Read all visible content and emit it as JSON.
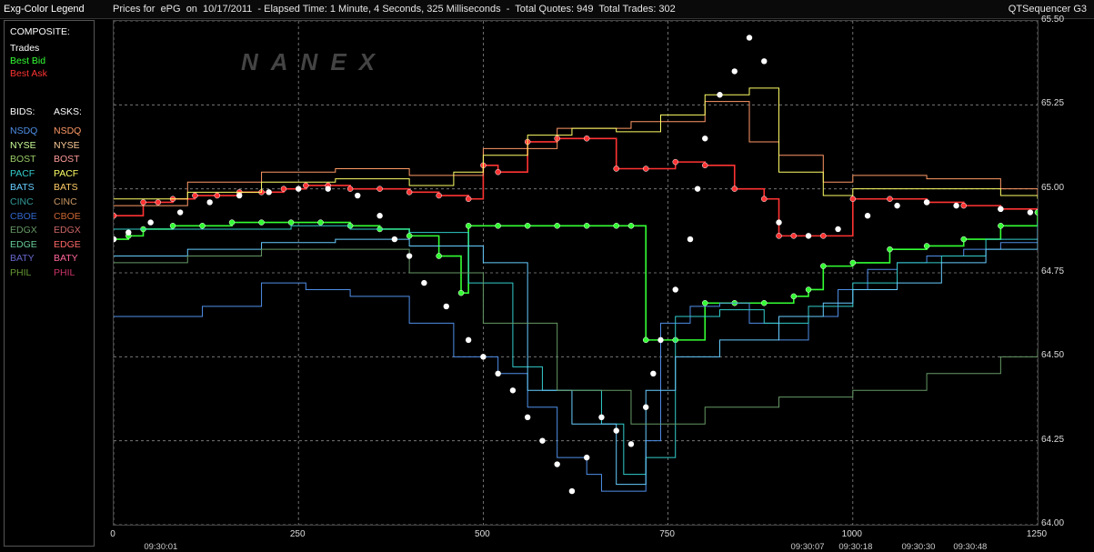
{
  "window": {
    "legend_title": "Exg-Color Legend",
    "chart_title": "Prices for  ePG  on  10/17/2011  - Elapsed Time: 1 Minute, 4 Seconds, 325 Milliseconds  -  Total Quotes: 949  Total Trades: 302",
    "app_name": "QTSequencer G3"
  },
  "legend": {
    "composite_label": "COMPOSITE:",
    "composite": [
      {
        "label": "Trades",
        "color": "#ffffff"
      },
      {
        "label": "Best Bid",
        "color": "#33ff33"
      },
      {
        "label": "Best Ask",
        "color": "#ff3333"
      }
    ],
    "bids_label": "BIDS:",
    "asks_label": "ASKS:",
    "exchanges": [
      {
        "bid": "NSDQ",
        "ask": "NSDQ",
        "bid_color": "#4f8fe8",
        "ask_color": "#ff9966"
      },
      {
        "bid": "NYSE",
        "ask": "NYSE",
        "bid_color": "#ccff99",
        "ask_color": "#ffcc99"
      },
      {
        "bid": "BOST",
        "ask": "BOST",
        "bid_color": "#99cc66",
        "ask_color": "#ff9999"
      },
      {
        "bid": "PACF",
        "ask": "PACF",
        "bid_color": "#33cccc",
        "ask_color": "#ffff66"
      },
      {
        "bid": "BATS",
        "ask": "BATS",
        "bid_color": "#66ccff",
        "ask_color": "#ffcc66"
      },
      {
        "bid": "CINC",
        "ask": "CINC",
        "bid_color": "#339999",
        "ask_color": "#cc9966"
      },
      {
        "bid": "CBOE",
        "ask": "CBOE",
        "bid_color": "#3366cc",
        "ask_color": "#cc6633"
      },
      {
        "bid": "EDGX",
        "ask": "EDGX",
        "bid_color": "#669966",
        "ask_color": "#cc6666"
      },
      {
        "bid": "EDGE",
        "ask": "EDGE",
        "bid_color": "#66cc99",
        "ask_color": "#ff6666"
      },
      {
        "bid": "BATY",
        "ask": "BATY",
        "bid_color": "#6666cc",
        "ask_color": "#ff6699"
      },
      {
        "bid": "PHIL",
        "ask": "PHIL",
        "bid_color": "#669933",
        "ask_color": "#cc3366"
      }
    ]
  },
  "watermark": "NANEX",
  "chart_data": {
    "type": "line",
    "title": "",
    "ylim": [
      64.0,
      65.5
    ],
    "xlim": [
      0,
      1250
    ],
    "y_ticks": [
      "65.50",
      "65.25",
      "65.00",
      "64.75",
      "64.50",
      "64.25",
      "64.00"
    ],
    "y_tick_values": [
      65.5,
      65.25,
      65.0,
      64.75,
      64.5,
      64.25,
      64.0
    ],
    "x_ticks": [
      "0",
      "250",
      "500",
      "750",
      "1000",
      "1250"
    ],
    "x_tick_values": [
      0,
      250,
      500,
      750,
      1000,
      1250
    ],
    "time_labels": [
      {
        "label": "09:30:01",
        "x": 65
      },
      {
        "label": "09:30:07",
        "x": 940
      },
      {
        "label": "09:30:18",
        "x": 1005
      },
      {
        "label": "09:30:30",
        "x": 1090
      },
      {
        "label": "09:30:48",
        "x": 1160
      }
    ],
    "grid": true,
    "series": [
      {
        "name": "Best Ask",
        "color": "#ff3333",
        "x": [
          0,
          40,
          60,
          80,
          110,
          140,
          170,
          200,
          230,
          260,
          290,
          320,
          360,
          400,
          440,
          480,
          500,
          520,
          560,
          600,
          640,
          680,
          720,
          760,
          800,
          840,
          880,
          900,
          920,
          960,
          1000,
          1050,
          1100,
          1150,
          1200,
          1250
        ],
        "y": [
          64.92,
          64.96,
          64.96,
          64.97,
          64.98,
          64.98,
          64.99,
          64.99,
          65.0,
          65.01,
          65.01,
          65.0,
          65.0,
          64.99,
          64.98,
          64.97,
          65.07,
          65.05,
          65.14,
          65.15,
          65.15,
          65.06,
          65.06,
          65.08,
          65.07,
          65.0,
          64.97,
          64.86,
          64.86,
          64.86,
          64.97,
          64.97,
          64.96,
          64.95,
          64.94,
          64.93
        ]
      },
      {
        "name": "Best Bid",
        "color": "#33ff33",
        "x": [
          0,
          20,
          40,
          80,
          120,
          160,
          200,
          240,
          280,
          320,
          360,
          400,
          440,
          470,
          480,
          520,
          560,
          600,
          640,
          680,
          700,
          720,
          760,
          800,
          840,
          880,
          920,
          940,
          960,
          1000,
          1050,
          1100,
          1150,
          1200,
          1250
        ],
        "y": [
          64.85,
          64.86,
          64.88,
          64.89,
          64.89,
          64.9,
          64.9,
          64.9,
          64.9,
          64.89,
          64.88,
          64.86,
          64.8,
          64.69,
          64.89,
          64.89,
          64.89,
          64.89,
          64.89,
          64.89,
          64.89,
          64.55,
          64.55,
          64.66,
          64.66,
          64.66,
          64.68,
          64.7,
          64.77,
          64.78,
          64.82,
          64.83,
          64.85,
          64.89,
          64.93
        ]
      },
      {
        "name": "NSDQ",
        "color": "#4f8fe8",
        "x": [
          0,
          60,
          120,
          200,
          260,
          320,
          400,
          460,
          520,
          560,
          600,
          640,
          660,
          700,
          720,
          740,
          780,
          820,
          860,
          900,
          940,
          980,
          1020,
          1060,
          1100,
          1150,
          1200,
          1250
        ],
        "y": [
          64.62,
          64.62,
          64.65,
          64.72,
          64.7,
          64.68,
          64.6,
          64.5,
          64.45,
          64.35,
          64.2,
          64.15,
          64.1,
          64.1,
          64.25,
          64.6,
          64.65,
          64.66,
          64.6,
          64.55,
          64.62,
          64.7,
          64.76,
          64.78,
          64.8,
          64.82,
          64.84,
          64.86
        ]
      },
      {
        "name": "PACF",
        "color": "#33cccc",
        "x": [
          0,
          80,
          160,
          240,
          320,
          400,
          480,
          540,
          580,
          620,
          660,
          690,
          720,
          760,
          820,
          880,
          940,
          1000,
          1060,
          1120,
          1180,
          1250
        ],
        "y": [
          64.88,
          64.88,
          64.88,
          64.89,
          64.88,
          64.87,
          64.72,
          64.47,
          64.4,
          64.4,
          64.3,
          64.15,
          64.2,
          64.62,
          64.64,
          64.6,
          64.65,
          64.72,
          64.78,
          64.8,
          64.85,
          64.9
        ]
      },
      {
        "name": "BATS",
        "color": "#66ccff",
        "x": [
          0,
          100,
          200,
          300,
          400,
          500,
          560,
          620,
          680,
          720,
          760,
          820,
          900,
          960,
          1000,
          1060,
          1120,
          1180,
          1250
        ],
        "y": [
          64.8,
          64.82,
          64.84,
          64.85,
          64.83,
          64.78,
          64.4,
          64.3,
          64.12,
          64.4,
          64.5,
          64.55,
          64.62,
          64.66,
          64.7,
          64.72,
          64.78,
          64.82,
          64.88
        ]
      },
      {
        "name": "EDGX",
        "color": "#669966",
        "x": [
          0,
          100,
          200,
          300,
          400,
          500,
          600,
          700,
          800,
          900,
          1000,
          1100,
          1200,
          1250
        ],
        "y": [
          64.78,
          64.8,
          64.82,
          64.82,
          64.75,
          64.6,
          64.4,
          64.3,
          64.35,
          64.38,
          64.4,
          64.45,
          64.5,
          64.52
        ]
      },
      {
        "name": "NSDQ ask",
        "color": "#ff9966",
        "x": [
          0,
          100,
          200,
          300,
          400,
          500,
          600,
          700,
          800,
          860,
          900,
          960,
          1000,
          1100,
          1200,
          1250
        ],
        "y": [
          64.95,
          65.02,
          65.05,
          65.06,
          65.04,
          65.12,
          65.18,
          65.2,
          65.26,
          65.14,
          65.1,
          65.02,
          65.04,
          65.03,
          65.0,
          64.98
        ]
      },
      {
        "name": "PACF ask",
        "color": "#ffff66",
        "x": [
          0,
          100,
          200,
          300,
          400,
          460,
          500,
          560,
          620,
          680,
          740,
          800,
          860,
          900,
          960,
          1000,
          1100,
          1200,
          1250
        ],
        "y": [
          64.97,
          64.99,
          65.02,
          65.03,
          65.01,
          65.05,
          65.1,
          65.16,
          65.18,
          65.17,
          65.22,
          65.28,
          65.3,
          65.05,
          64.98,
          65.0,
          65.0,
          64.98,
          64.97
        ]
      }
    ],
    "trades": {
      "name": "Trades",
      "color": "#ffffff",
      "x": [
        0,
        20,
        50,
        90,
        130,
        170,
        210,
        250,
        290,
        330,
        360,
        380,
        400,
        420,
        450,
        480,
        500,
        520,
        540,
        560,
        580,
        600,
        620,
        640,
        660,
        680,
        700,
        720,
        730,
        740,
        760,
        780,
        790,
        800,
        820,
        840,
        860,
        880,
        900,
        940,
        980,
        1020,
        1060,
        1100,
        1140,
        1200,
        1240
      ],
      "y": [
        64.85,
        64.87,
        64.9,
        64.93,
        64.96,
        64.98,
        64.99,
        65.0,
        65.0,
        64.98,
        64.92,
        64.85,
        64.8,
        64.72,
        64.65,
        64.55,
        64.5,
        64.45,
        64.4,
        64.32,
        64.25,
        64.18,
        64.1,
        64.2,
        64.32,
        64.28,
        64.24,
        64.35,
        64.45,
        64.55,
        64.7,
        64.85,
        65.0,
        65.15,
        65.28,
        65.35,
        65.45,
        65.38,
        64.9,
        64.86,
        64.88,
        64.92,
        64.95,
        64.96,
        64.95,
        64.94,
        64.93
      ]
    }
  }
}
